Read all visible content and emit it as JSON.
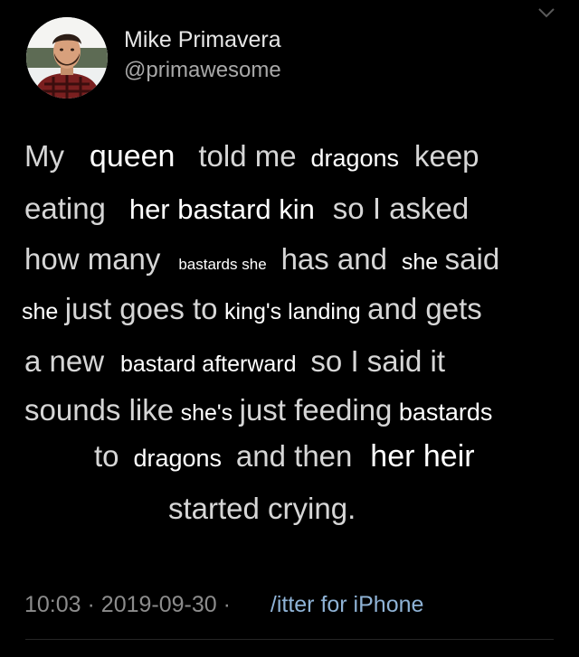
{
  "author": {
    "display_name": "Mike Primavera",
    "handle": "@primawesome",
    "avatar_icon": "profile-photo"
  },
  "menu_icon": "chevron-down-icon",
  "tweet_lines": [
    [
      {
        "text": "My",
        "style": "orig"
      },
      {
        "text": "queen",
        "style": "edit e-xl"
      },
      {
        "text": "told me",
        "style": "orig"
      },
      {
        "text": "dragons",
        "style": "edit e-m"
      },
      {
        "text": "keep",
        "style": "orig"
      }
    ],
    [
      {
        "text": "eating",
        "style": "orig"
      },
      {
        "text": "her bastard kin",
        "style": "edit e-l"
      },
      {
        "text": "so I asked",
        "style": "orig"
      }
    ],
    [
      {
        "text": "how many",
        "style": "orig"
      },
      {
        "text": "bastards she",
        "style": "edit e-xs"
      },
      {
        "text": "has and",
        "style": "orig"
      },
      {
        "text": "she",
        "style": "edit e-s"
      },
      {
        "text": "said",
        "style": "orig"
      }
    ],
    [
      {
        "text": "she",
        "style": "edit e-s"
      },
      {
        "text": "just goes to",
        "style": "orig"
      },
      {
        "text": "king's landing",
        "style": "edit e-s"
      },
      {
        "text": "and gets",
        "style": "orig"
      }
    ],
    [
      {
        "text": "a new",
        "style": "orig"
      },
      {
        "text": "bastard afterward",
        "style": "edit e-s"
      },
      {
        "text": "so I said it",
        "style": "orig"
      }
    ],
    [
      {
        "text": "sounds like",
        "style": "orig"
      },
      {
        "text": "she's",
        "style": "edit e-s"
      },
      {
        "text": "just feeding",
        "style": "orig"
      },
      {
        "text": "bastards",
        "style": "edit e-m"
      }
    ],
    [
      {
        "text": "to",
        "style": "orig"
      },
      {
        "text": "dragons",
        "style": "edit e-m"
      },
      {
        "text": "and then",
        "style": "orig"
      },
      {
        "text": "her heir",
        "style": "edit e-xl"
      }
    ],
    [
      {
        "text": "started crying.",
        "style": "orig"
      }
    ]
  ],
  "meta": {
    "time": "10:03",
    "date": "2019-09-30",
    "separator": "·",
    "source": "/itter for iPhone"
  },
  "colors": {
    "background": "#000000",
    "text": "#d6d6d6",
    "meta": "#8c8c8c",
    "source_link": "#8fb3d6"
  }
}
